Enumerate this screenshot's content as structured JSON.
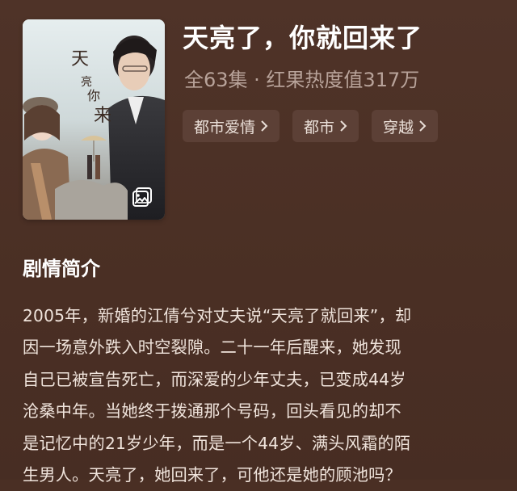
{
  "drama": {
    "title": "天亮了，你就回来了",
    "meta": "全63集 · 红果热度值317万"
  },
  "tags": [
    {
      "label": "都市爱情"
    },
    {
      "label": "都市"
    },
    {
      "label": "穿越"
    }
  ],
  "summary_section": {
    "heading": "剧情简介",
    "lines": [
      "2005年，新婚的江倩兮对丈夫说“天亮了就回来”，却",
      "因一场意外跌入时空裂隙。二十一年后醒来，她发现",
      "自己已被宣告死亡，而深爱的少年丈夫，已变成44岁",
      "沧桑中年。当她终于拨通那个号码，回头看见的却不",
      "是记忆中的21岁少年，而是一个44岁、满头风霜的陌",
      "生男人。天亮了，她回来了，可他还是她的顾池吗？"
    ]
  },
  "colors": {
    "background": "#4a2f24",
    "tag_bg": "#5c4036",
    "meta_text": "#b8a39a"
  },
  "icons": {
    "gallery": "image-gallery-icon",
    "tag_arrow": "chevron-right-icon"
  }
}
